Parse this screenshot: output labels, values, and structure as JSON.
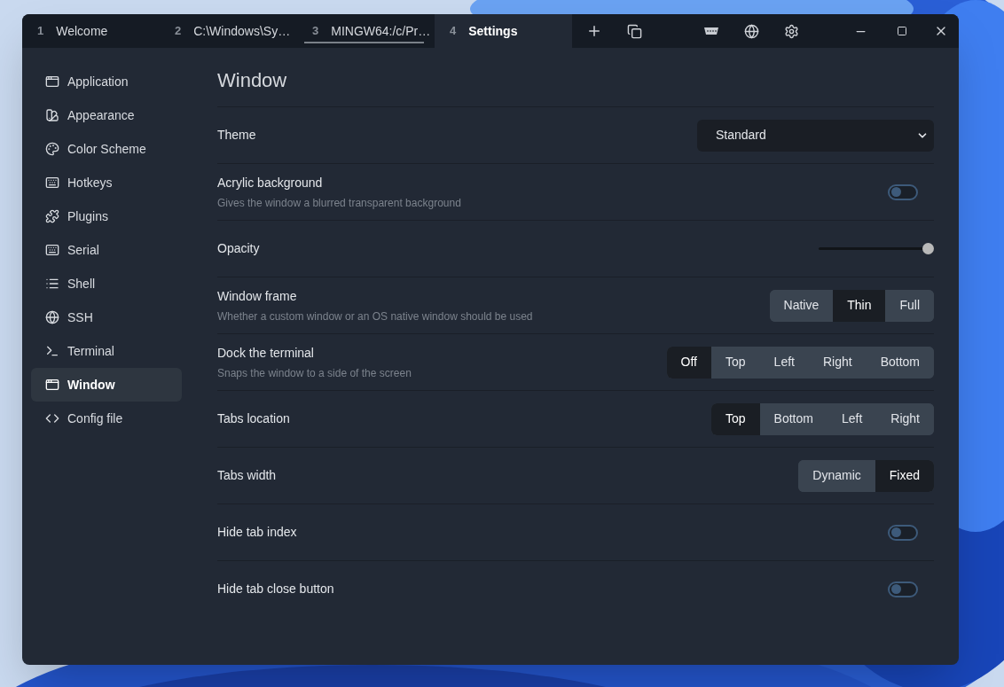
{
  "tabs": [
    {
      "index": "1",
      "title": "Welcome",
      "selected": false,
      "underlined": false
    },
    {
      "index": "2",
      "title": "C:\\Windows\\Sy…",
      "selected": false,
      "underlined": false
    },
    {
      "index": "3",
      "title": "MINGW64:/c/Pr…",
      "selected": false,
      "underlined": true
    },
    {
      "index": "4",
      "title": "Settings",
      "selected": true,
      "underlined": false
    }
  ],
  "sidebar": {
    "items": [
      {
        "label": "Application",
        "selected": false
      },
      {
        "label": "Appearance",
        "selected": false
      },
      {
        "label": "Color Scheme",
        "selected": false
      },
      {
        "label": "Hotkeys",
        "selected": false
      },
      {
        "label": "Plugins",
        "selected": false
      },
      {
        "label": "Serial",
        "selected": false
      },
      {
        "label": "Shell",
        "selected": false
      },
      {
        "label": "SSH",
        "selected": false
      },
      {
        "label": "Terminal",
        "selected": false
      },
      {
        "label": "Window",
        "selected": true
      },
      {
        "label": "Config file",
        "selected": false
      }
    ]
  },
  "section_title": "Window",
  "settings": [
    {
      "kind": "dropdown",
      "label": "Theme",
      "value": "Standard"
    },
    {
      "kind": "toggle",
      "label": "Acrylic background",
      "description": "Gives the window a blurred transparent background",
      "on": false
    },
    {
      "kind": "slider",
      "label": "Opacity",
      "level": 1
    },
    {
      "kind": "segmented",
      "label": "Window frame",
      "description": "Whether a custom window or an OS native window should be used",
      "options": [
        {
          "label": "Native",
          "selected": false
        },
        {
          "label": "Thin",
          "selected": true
        },
        {
          "label": "Full",
          "selected": false
        }
      ]
    },
    {
      "kind": "segmented",
      "label": "Dock the terminal",
      "description": "Snaps the window to a side of the screen",
      "options": [
        {
          "label": "Off",
          "selected": true
        },
        {
          "label": "Top",
          "selected": false
        },
        {
          "label": "Left",
          "selected": false
        },
        {
          "label": "Right",
          "selected": false
        },
        {
          "label": "Bottom",
          "selected": false
        }
      ]
    },
    {
      "kind": "segmented",
      "label": "Tabs location",
      "options": [
        {
          "label": "Top",
          "selected": true
        },
        {
          "label": "Bottom",
          "selected": false
        },
        {
          "label": "Left",
          "selected": false
        },
        {
          "label": "Right",
          "selected": false
        }
      ]
    },
    {
      "kind": "segmented",
      "label": "Tabs width",
      "options": [
        {
          "label": "Dynamic",
          "selected": false
        },
        {
          "label": "Fixed",
          "selected": true
        }
      ]
    },
    {
      "kind": "toggle",
      "label": "Hide tab index",
      "on": false
    },
    {
      "kind": "toggle",
      "label": "Hide tab close button",
      "on": false
    }
  ]
}
